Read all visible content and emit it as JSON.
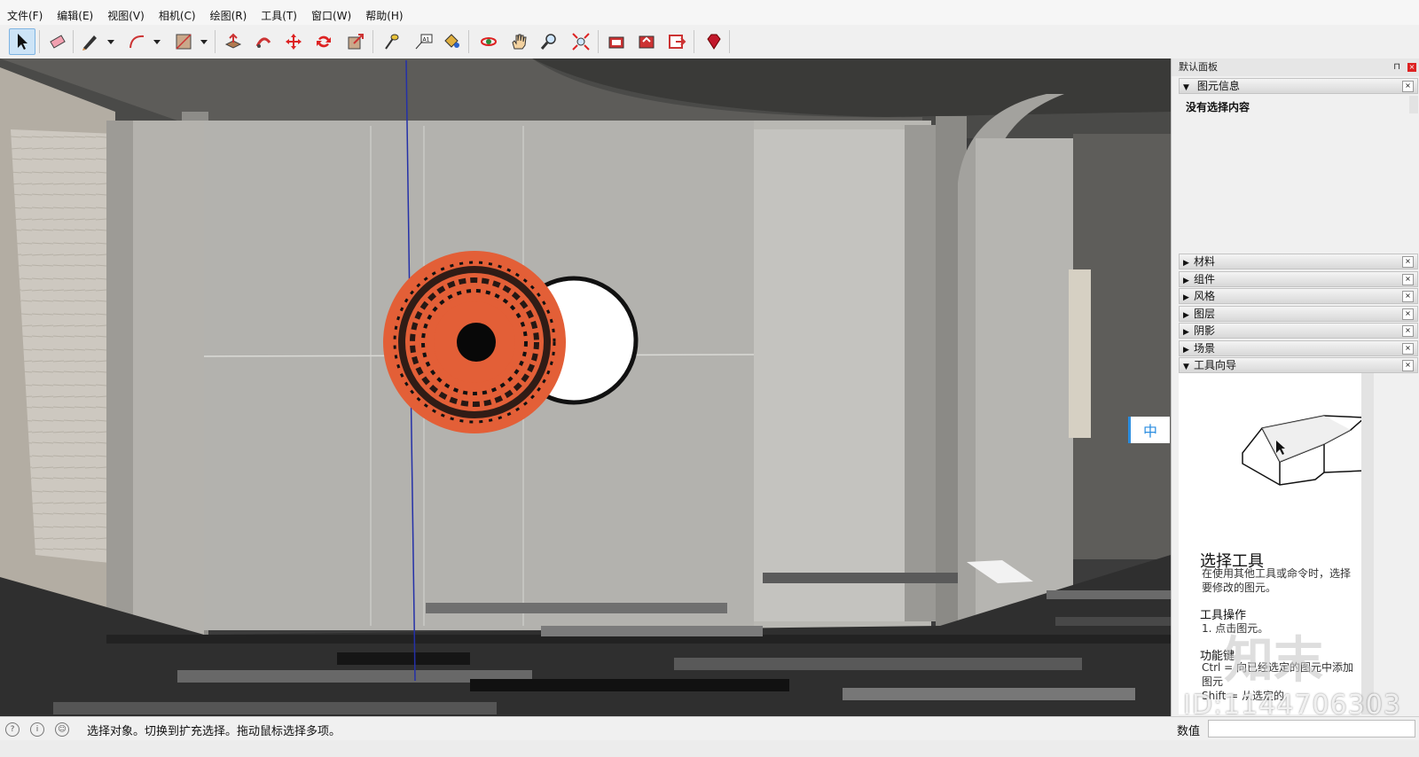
{
  "menu": [
    "文件(F)",
    "编辑(E)",
    "视图(V)",
    "相机(C)",
    "绘图(R)",
    "工具(T)",
    "窗口(W)",
    "帮助(H)"
  ],
  "toolbar": {
    "tools": [
      "select-icon",
      "eraser-icon",
      "pencil-icon",
      "arc-icon",
      "rectangle-icon",
      "pushpull-icon",
      "followme-icon",
      "move-icon",
      "rotate-icon",
      "scale-icon",
      "tape-measure-icon",
      "text-icon",
      "paint-bucket-icon",
      "orbit-icon",
      "pan-icon",
      "zoom-icon",
      "zoom-extents-icon",
      "warehouse-icon",
      "share-model-icon",
      "extension-icon",
      "ruby-icon"
    ],
    "text_tool_label": "A1"
  },
  "ime": {
    "label": "中"
  },
  "tray": {
    "title": "默认面板",
    "entity_info": {
      "label": "图元信息",
      "status": "没有选择内容"
    },
    "panels": [
      "材料",
      "组件",
      "风格",
      "图层",
      "阴影",
      "场景",
      "工具向导"
    ],
    "guide": {
      "title": "选择工具",
      "desc": "在使用其他工具或命令时，选择要修改的图元。",
      "ops_heading": "工具操作",
      "ops_step": "1. 点击图元。",
      "func_heading": "功能键",
      "func_line1": "Ctrl = 向已经选定的图元中添加图元",
      "func_line2": "Shift = 从选定的"
    }
  },
  "status": {
    "message": "选择对象。切换到扩充选择。拖动鼠标选择多项。",
    "vcb_label": "数值",
    "vcb_value": ""
  },
  "watermark": {
    "id_text": "ID:1144706303",
    "logo_text": "知末"
  },
  "colors": {
    "accent": "#2a8de0",
    "orange": "#e35f37",
    "wall": "#b9b8b3"
  }
}
